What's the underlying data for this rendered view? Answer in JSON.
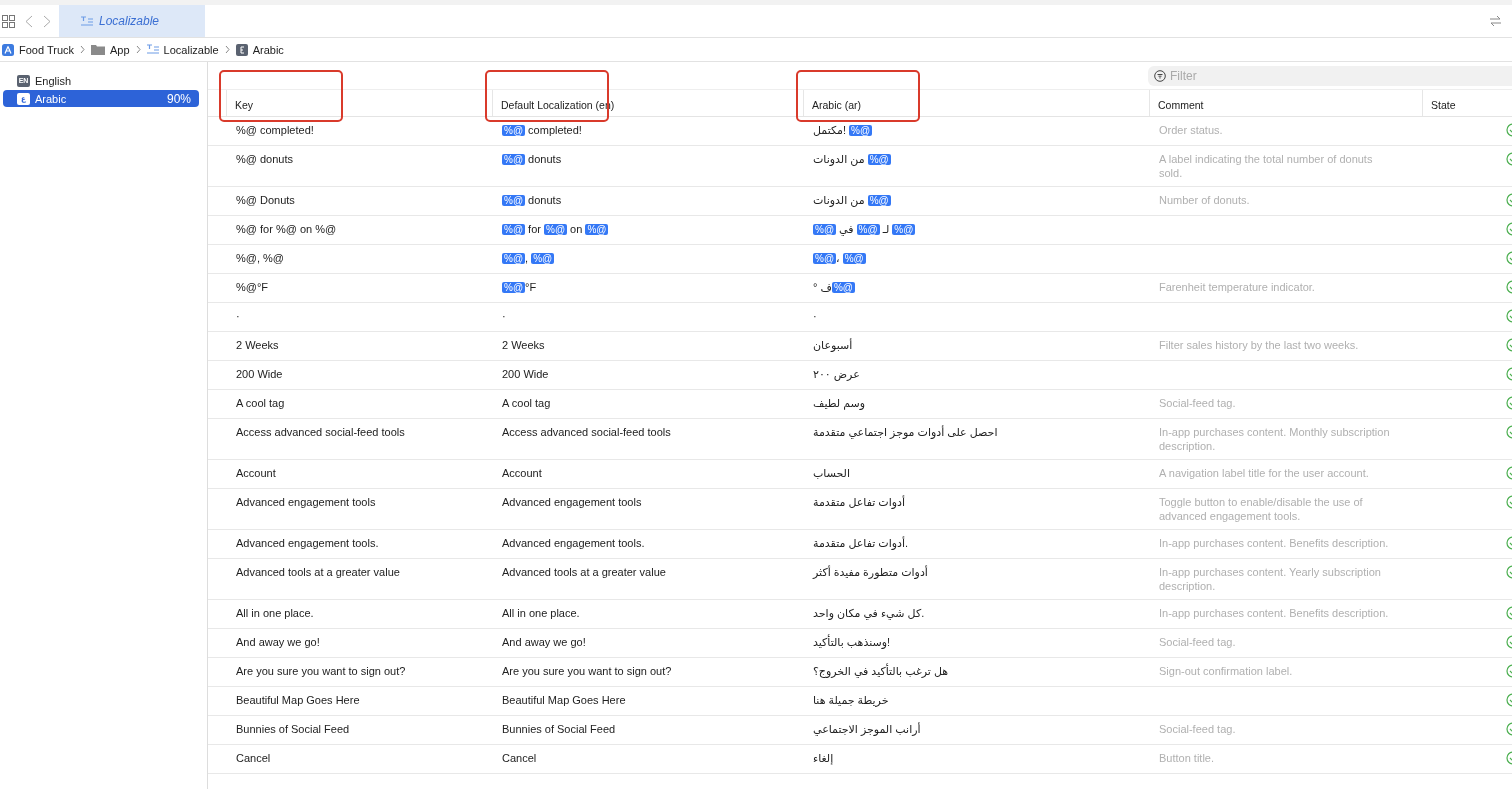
{
  "toolbar": {
    "tab": "Localizable"
  },
  "breadcrumb": [
    {
      "kind": "app",
      "label": "Food Truck"
    },
    {
      "kind": "folder",
      "label": "App"
    },
    {
      "kind": "strings",
      "label": "Localizable"
    },
    {
      "kind": "language",
      "label": "Arabic"
    }
  ],
  "languages": [
    {
      "badge": "EN",
      "label": "English",
      "selected": false
    },
    {
      "badge": "ع",
      "label": "Arabic",
      "progress": "90%",
      "selected": true
    }
  ],
  "filter": {
    "placeholder": "Filter"
  },
  "columns": [
    {
      "label": "Key",
      "highlighted": true
    },
    {
      "label": "Default Localization (en)",
      "highlighted": true
    },
    {
      "label": "Arabic (ar)",
      "highlighted": true
    },
    {
      "label": "Comment",
      "highlighted": false
    },
    {
      "label": "State",
      "highlighted": false
    }
  ],
  "rows": [
    {
      "key": [
        {
          "kind": "text",
          "text": "%@ completed!"
        }
      ],
      "default": [
        {
          "kind": "token",
          "text": "%@"
        },
        {
          "kind": "text",
          "text": " completed!"
        }
      ],
      "arabic": [
        {
          "kind": "text",
          "text": "مكتمل! "
        },
        {
          "kind": "token",
          "text": "%@"
        }
      ],
      "comment": "Order status.",
      "translated": true
    },
    {
      "key": [
        {
          "kind": "text",
          "text": "%@ donuts"
        }
      ],
      "default": [
        {
          "kind": "token",
          "text": "%@"
        },
        {
          "kind": "text",
          "text": " donuts"
        }
      ],
      "arabic": [
        {
          "kind": "text",
          "text": "من الدونات "
        },
        {
          "kind": "token",
          "text": "%@"
        }
      ],
      "comment": "A label indicating the total number of donuts sold.",
      "translated": true
    },
    {
      "key": [
        {
          "kind": "text",
          "text": "%@ Donuts"
        }
      ],
      "default": [
        {
          "kind": "token",
          "text": "%@"
        },
        {
          "kind": "text",
          "text": " donuts"
        }
      ],
      "arabic": [
        {
          "kind": "text",
          "text": "من الدونات "
        },
        {
          "kind": "token",
          "text": "%@"
        }
      ],
      "comment": "Number of donuts.",
      "translated": true
    },
    {
      "key": [
        {
          "kind": "text",
          "text": "%@ for %@ on %@"
        }
      ],
      "default": [
        {
          "kind": "token",
          "text": "%@"
        },
        {
          "kind": "text",
          "text": " for "
        },
        {
          "kind": "token",
          "text": "%@"
        },
        {
          "kind": "text",
          "text": " on "
        },
        {
          "kind": "token",
          "text": "%@"
        }
      ],
      "arabic": [
        {
          "kind": "token",
          "text": "%@"
        },
        {
          "kind": "text",
          "text": " في "
        },
        {
          "kind": "token",
          "text": "%@"
        },
        {
          "kind": "text",
          "text": " لـ "
        },
        {
          "kind": "token",
          "text": "%@"
        }
      ],
      "translated": true
    },
    {
      "key": [
        {
          "kind": "text",
          "text": "%@, %@"
        }
      ],
      "default": [
        {
          "kind": "token",
          "text": "%@"
        },
        {
          "kind": "text",
          "text": ", "
        },
        {
          "kind": "token",
          "text": "%@"
        }
      ],
      "arabic": [
        {
          "kind": "token",
          "text": "%@"
        },
        {
          "kind": "text",
          "text": "، "
        },
        {
          "kind": "token",
          "text": "%@"
        }
      ],
      "translated": true
    },
    {
      "key": [
        {
          "kind": "text",
          "text": "%@°F"
        }
      ],
      "default": [
        {
          "kind": "token",
          "text": "%@"
        },
        {
          "kind": "text",
          "text": "°F"
        }
      ],
      "arabic": [
        {
          "kind": "text",
          "text": "° ف"
        },
        {
          "kind": "token",
          "text": "%@"
        }
      ],
      "comment": "Farenheit temperature indicator.",
      "translated": true
    },
    {
      "key": [
        {
          "kind": "text",
          "text": "·"
        }
      ],
      "default": [
        {
          "kind": "text",
          "text": "·"
        }
      ],
      "arabic": [
        {
          "kind": "text",
          "text": "·"
        }
      ],
      "translated": true
    },
    {
      "key": [
        {
          "kind": "text",
          "text": "2 Weeks"
        }
      ],
      "default": [
        {
          "kind": "text",
          "text": "2 Weeks"
        }
      ],
      "arabic": [
        {
          "kind": "text",
          "text": "أسبوعان"
        }
      ],
      "comment": "Filter sales history by the last two weeks.",
      "translated": true
    },
    {
      "key": [
        {
          "kind": "text",
          "text": "200 Wide"
        }
      ],
      "default": [
        {
          "kind": "text",
          "text": "200 Wide"
        }
      ],
      "arabic": [
        {
          "kind": "text",
          "text": "عرض ٢٠٠"
        }
      ],
      "translated": true
    },
    {
      "key": [
        {
          "kind": "text",
          "text": "A cool tag"
        }
      ],
      "default": [
        {
          "kind": "text",
          "text": "A cool tag"
        }
      ],
      "arabic": [
        {
          "kind": "text",
          "text": "وسم لطيف"
        }
      ],
      "comment": "Social-feed tag.",
      "translated": true
    },
    {
      "key": [
        {
          "kind": "text",
          "text": "Access advanced social-feed tools"
        }
      ],
      "default": [
        {
          "kind": "text",
          "text": "Access advanced social-feed tools"
        }
      ],
      "arabic": [
        {
          "kind": "text",
          "text": "احصل على أدوات موجز اجتماعي متقدمة"
        }
      ],
      "comment": "In-app purchases content. Monthly subscription description.",
      "translated": true
    },
    {
      "key": [
        {
          "kind": "text",
          "text": "Account"
        }
      ],
      "default": [
        {
          "kind": "text",
          "text": "Account"
        }
      ],
      "arabic": [
        {
          "kind": "text",
          "text": "الحساب"
        }
      ],
      "comment": "A navigation label title for the user account.",
      "translated": true
    },
    {
      "key": [
        {
          "kind": "text",
          "text": "Advanced engagement tools"
        }
      ],
      "default": [
        {
          "kind": "text",
          "text": "Advanced engagement tools"
        }
      ],
      "arabic": [
        {
          "kind": "text",
          "text": "أدوات تفاعل متقدمة"
        }
      ],
      "comment": "Toggle button to enable/disable the use of advanced engagement tools.",
      "translated": true
    },
    {
      "key": [
        {
          "kind": "text",
          "text": "Advanced engagement tools."
        }
      ],
      "default": [
        {
          "kind": "text",
          "text": "Advanced engagement tools."
        }
      ],
      "arabic": [
        {
          "kind": "text",
          "text": "أدوات تفاعل متقدمة."
        }
      ],
      "comment": "In-app purchases content. Benefits description.",
      "translated": true
    },
    {
      "key": [
        {
          "kind": "text",
          "text": "Advanced tools at a greater value"
        }
      ],
      "default": [
        {
          "kind": "text",
          "text": "Advanced tools at a greater value"
        }
      ],
      "arabic": [
        {
          "kind": "text",
          "text": "أدوات متطورة مفيدة أكثر"
        }
      ],
      "comment": "In-app purchases content. Yearly subscription description.",
      "translated": true
    },
    {
      "key": [
        {
          "kind": "text",
          "text": "All in one place."
        }
      ],
      "default": [
        {
          "kind": "text",
          "text": "All in one place."
        }
      ],
      "arabic": [
        {
          "kind": "text",
          "text": "كل شيء في مكان واحد."
        }
      ],
      "comment": "In-app purchases content. Benefits description.",
      "translated": true
    },
    {
      "key": [
        {
          "kind": "text",
          "text": "And away we go!"
        }
      ],
      "default": [
        {
          "kind": "text",
          "text": "And away we go!"
        }
      ],
      "arabic": [
        {
          "kind": "text",
          "text": "وسنذهب بالتأكيد!"
        }
      ],
      "comment": "Social-feed tag.",
      "translated": true
    },
    {
      "key": [
        {
          "kind": "text",
          "text": "Are you sure you want to sign out?"
        }
      ],
      "default": [
        {
          "kind": "text",
          "text": "Are you sure you want to sign out?"
        }
      ],
      "arabic": [
        {
          "kind": "text",
          "text": "هل ترغب بالتأكيد في الخروج؟"
        }
      ],
      "comment": "Sign-out confirmation label.",
      "translated": true
    },
    {
      "key": [
        {
          "kind": "text",
          "text": "Beautiful Map Goes Here"
        }
      ],
      "default": [
        {
          "kind": "text",
          "text": "Beautiful Map Goes Here"
        }
      ],
      "arabic": [
        {
          "kind": "text",
          "text": "خريطة جميلة هنا"
        }
      ],
      "translated": true
    },
    {
      "key": [
        {
          "kind": "text",
          "text": "Bunnies of Social Feed"
        }
      ],
      "default": [
        {
          "kind": "text",
          "text": "Bunnies of Social Feed"
        }
      ],
      "arabic": [
        {
          "kind": "text",
          "text": "أرانب الموجز الاجتماعي"
        }
      ],
      "comment": "Social-feed tag.",
      "translated": true
    },
    {
      "key": [
        {
          "kind": "text",
          "text": "Cancel"
        }
      ],
      "default": [
        {
          "kind": "text",
          "text": "Cancel"
        }
      ],
      "arabic": [
        {
          "kind": "text",
          "text": "إلغاء"
        }
      ],
      "comment": "Button title.",
      "translated": true
    }
  ]
}
